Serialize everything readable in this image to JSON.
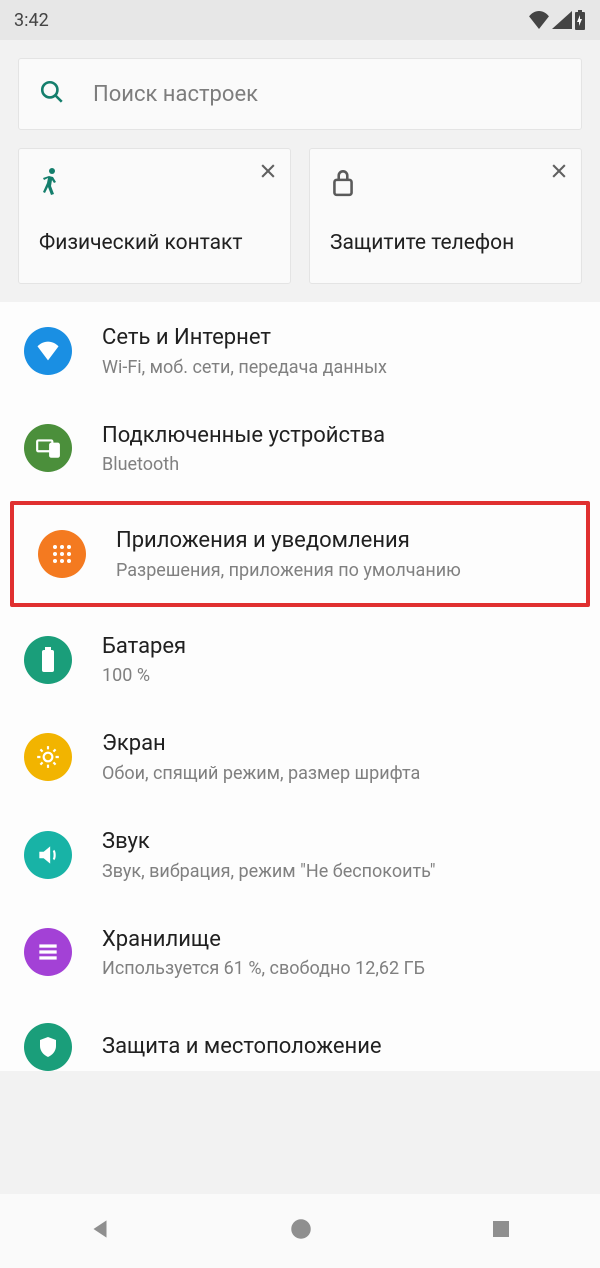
{
  "status": {
    "time": "3:42"
  },
  "search": {
    "placeholder": "Поиск настроек"
  },
  "cards": [
    {
      "title": "Физический контакт"
    },
    {
      "title": "Защитите телефон"
    }
  ],
  "items": [
    {
      "title": "Сеть и Интернет",
      "sub": "Wi-Fi, моб. сети, передача данных",
      "color": "#1a8fe3",
      "icon": "wifi"
    },
    {
      "title": "Подключенные устройства",
      "sub": "Bluetooth",
      "color": "#4b8f3b",
      "icon": "devices"
    },
    {
      "title": "Приложения и уведомления",
      "sub": "Разрешения, приложения по умолчанию",
      "color": "#f47a20",
      "icon": "apps",
      "highlight": true
    },
    {
      "title": "Батарея",
      "sub": "100 %",
      "color": "#1a9e7a",
      "icon": "battery"
    },
    {
      "title": "Экран",
      "sub": "Обои, спящий режим, размер шрифта",
      "color": "#f2b400",
      "icon": "display"
    },
    {
      "title": "Звук",
      "sub": "Звук, вибрация, режим \"Не беспокоить\"",
      "color": "#18b3a6",
      "icon": "sound"
    },
    {
      "title": "Хранилище",
      "sub": "Используется 61 %, свободно 12,62 ГБ",
      "color": "#a341d6",
      "icon": "storage"
    },
    {
      "title": "Защита и местоположение",
      "sub": "",
      "color": "#1a9e7a",
      "icon": "security"
    }
  ]
}
